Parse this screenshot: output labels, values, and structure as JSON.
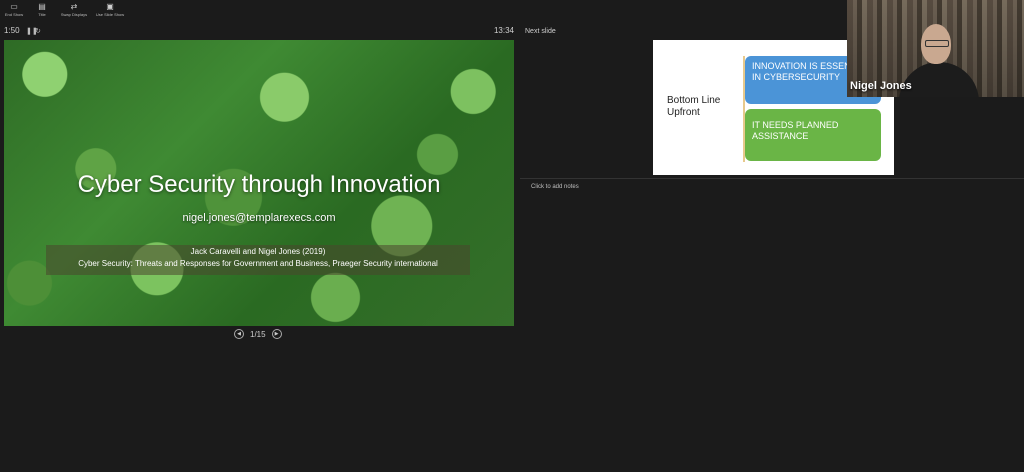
{
  "toolbar": {
    "buttons": [
      {
        "label": "End Show",
        "icon": "presentation-icon"
      },
      {
        "label": "Title",
        "icon": "slide-icon"
      },
      {
        "label": "Swap Displays",
        "icon": "swap-icon"
      },
      {
        "label": "Use Slide Show",
        "icon": "slideshow-icon"
      }
    ]
  },
  "timer": {
    "elapsed": "1:50",
    "clock": "13:34"
  },
  "current_slide": {
    "title": "Cyber Security through Innovation",
    "email": "nigel.jones@templarexecs.com",
    "citation_line1": "Jack Caravelli and Nigel Jones (2019)",
    "citation_line2": "Cyber Security: Threats and Responses for Government and Business, Praeger Security international"
  },
  "navigation": {
    "page": "1/15"
  },
  "next_slide": {
    "label": "Next slide",
    "left_text": "Bottom Line Upfront",
    "box1": "INNOVATION IS ESSENTIAL IN CYBERSECURITY",
    "box2": "IT NEEDS PLANNED ASSISTANCE",
    "colors": {
      "box1": "#4b94d7",
      "box2": "#6ab546"
    }
  },
  "notes": {
    "placeholder": "Click to add notes"
  },
  "webcam": {
    "name": "Nigel Jones"
  }
}
